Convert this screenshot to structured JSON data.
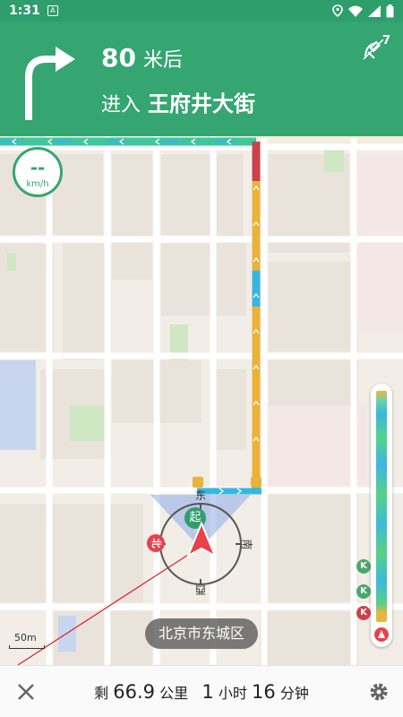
{
  "status_bar": {
    "time": "1:31",
    "app_icon": "A"
  },
  "nav_banner": {
    "distance_value": "80",
    "distance_unit": "米后",
    "road_prefix": "进入",
    "road_name": "王府井大街",
    "gps_count": "7",
    "turn_icon": "turn-right-arrow-icon"
  },
  "map": {
    "speed_value": "--",
    "speed_unit": "km/h",
    "start_marker": "起",
    "compass_east": "东",
    "compass_south": "南",
    "compass_west": "西",
    "subway_marker": "北",
    "district": "北京市东城区",
    "scale": "50m",
    "route_markers": [
      "K",
      "K",
      "K"
    ]
  },
  "bottom_bar": {
    "remaining_prefix": "剩",
    "remaining_distance": "66.9",
    "remaining_distance_unit": "公里",
    "remaining_hours": "1",
    "remaining_hours_unit": "小时",
    "remaining_minutes": "16",
    "remaining_minutes_unit": "分钟"
  },
  "colors": {
    "accent": "#35a572",
    "route_green": "#3ec79a",
    "route_yellow": "#e9b339",
    "route_red": "#c9434c",
    "marker_red": "#e8424d"
  }
}
